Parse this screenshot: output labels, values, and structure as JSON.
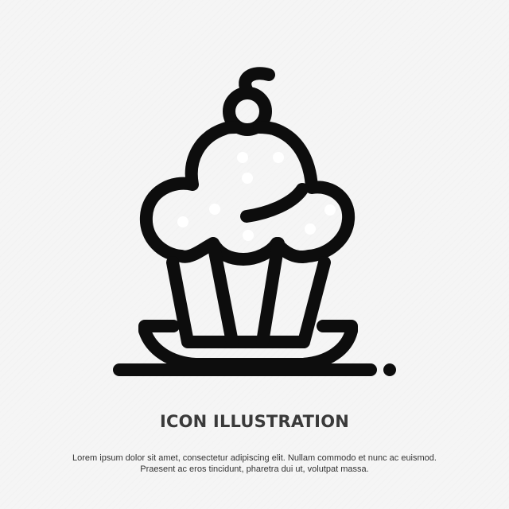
{
  "icon": {
    "name": "cupcake-icon",
    "stroke_color": "#0d0d0d",
    "background": "#f5f5f5"
  },
  "title": "ICON ILLUSTRATION",
  "caption": {
    "line1": "Lorem ipsum dolor sit amet, consectetur adipiscing elit. Nullam commodo et nunc ac euismod.",
    "line2": "Praesent ac eros tincidunt, pharetra dui ut, volutpat massa."
  },
  "colors": {
    "title": "#3a3a3a",
    "caption": "#333333"
  }
}
